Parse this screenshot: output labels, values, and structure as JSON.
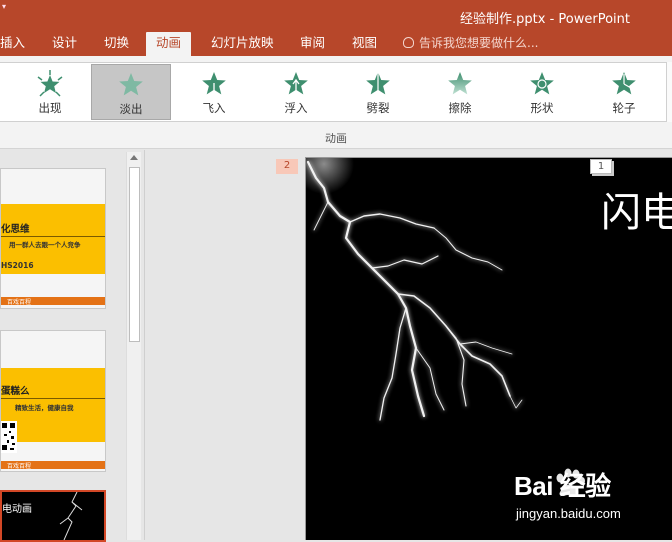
{
  "window": {
    "title": "经验制作.pptx - PowerPoint"
  },
  "tabs": [
    {
      "label": "插入"
    },
    {
      "label": "设计"
    },
    {
      "label": "切换"
    },
    {
      "label": "动画",
      "active": true
    },
    {
      "label": "幻灯片放映"
    },
    {
      "label": "审阅"
    },
    {
      "label": "视图"
    }
  ],
  "tell_me": {
    "placeholder": "告诉我您想要做什么...",
    "icon": "lightbulb-icon"
  },
  "ribbon": {
    "animations": [
      {
        "label": "出现",
        "icon": "appear-star-icon"
      },
      {
        "label": "淡出",
        "icon": "fade-star-icon",
        "selected": true
      },
      {
        "label": "飞入",
        "icon": "fly-in-star-icon"
      },
      {
        "label": "浮入",
        "icon": "float-in-star-icon"
      },
      {
        "label": "劈裂",
        "icon": "split-star-icon"
      },
      {
        "label": "擦除",
        "icon": "wipe-star-icon"
      },
      {
        "label": "形状",
        "icon": "shape-star-icon"
      },
      {
        "label": "轮子",
        "icon": "wheel-star-icon"
      }
    ],
    "group_label": "动画",
    "accent": "#b7472a",
    "star_color": "#3f8f6f"
  },
  "thumbnails": [
    {
      "title": "化思维",
      "subtitle": "用一群人去跟一个人竞争",
      "code": "HS2016",
      "footer": "百戏百程"
    },
    {
      "title": "蛋糕么",
      "subtitle": "精致生活，健康自我",
      "footer": "百戏百程"
    },
    {
      "title": "电动画"
    }
  ],
  "slide": {
    "title": "闪电",
    "animation_tags": [
      "2",
      "1"
    ]
  },
  "watermark": {
    "logo": "Bai 经验",
    "url": "jingyan.baidu.com"
  }
}
